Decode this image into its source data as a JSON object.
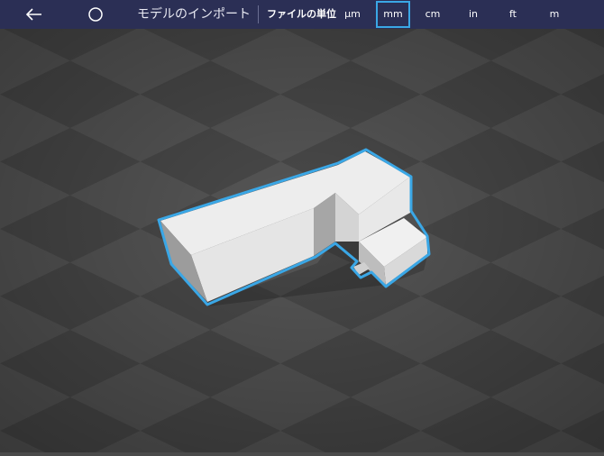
{
  "toolbar": {
    "title": "モデルのインポート",
    "units_label": "ファイルの単位",
    "units": [
      "µm",
      "mm",
      "cm",
      "in",
      "ft",
      "m"
    ],
    "selected_unit": "mm"
  },
  "icons": {
    "back": "back-arrow-icon",
    "home": "circle-icon"
  },
  "colors": {
    "toolbar_bg": "#2b2f55",
    "accent": "#3aa7e6",
    "grid_dark": "#444444",
    "grid_light": "#555555",
    "model": "#e2e2e2"
  }
}
